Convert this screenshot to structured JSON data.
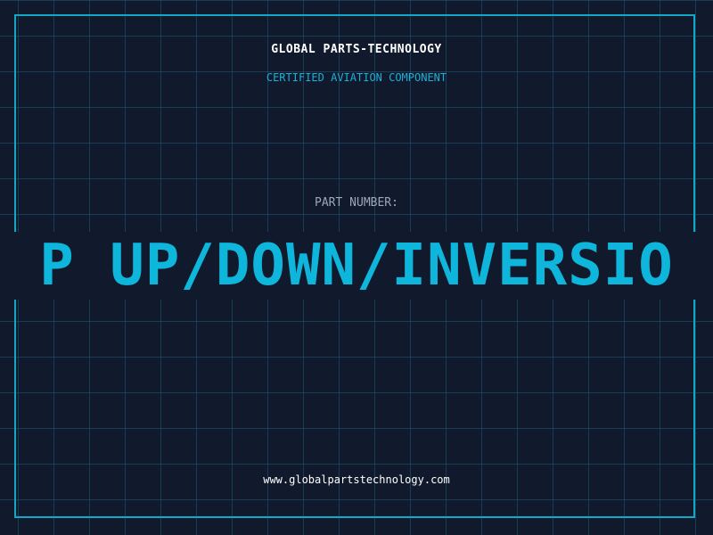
{
  "header": {
    "company": "GLOBAL PARTS-TECHNOLOGY",
    "tagline": "CERTIFIED AVIATION COMPONENT"
  },
  "part": {
    "label": "PART NUMBER:",
    "value": "P UP/DOWN/INVERSIO"
  },
  "footer": {
    "website": "www.globalpartstechnology.com"
  },
  "colors": {
    "background": "#111a2c",
    "accent": "#0fb6dc",
    "grid": "#1e5a78"
  }
}
